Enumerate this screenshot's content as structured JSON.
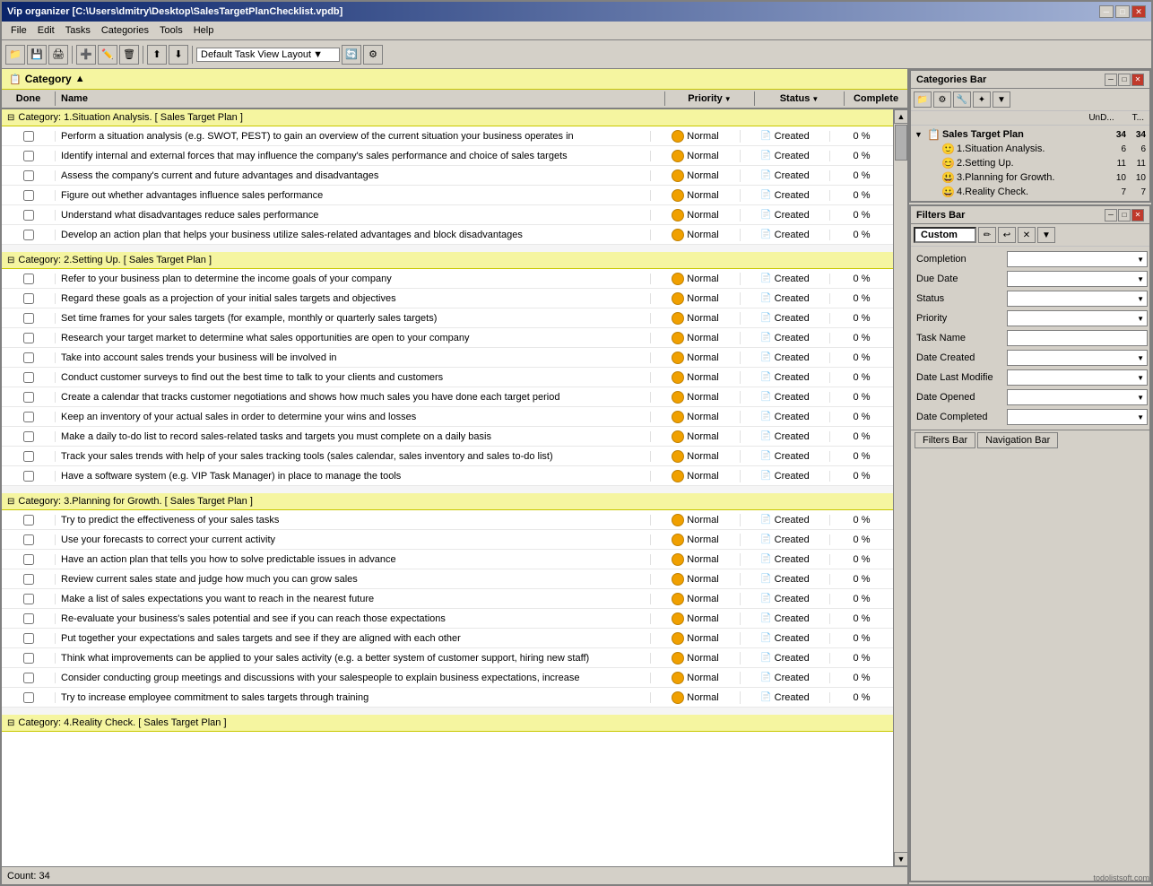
{
  "window": {
    "title": "Vip organizer [C:\\Users\\dmitry\\Desktop\\SalesTargetPlanChecklist.vpdb]",
    "minimize_label": "─",
    "maximize_label": "□",
    "close_label": "✕"
  },
  "menu": {
    "items": [
      "File",
      "Edit",
      "Tasks",
      "Categories",
      "Tools",
      "Help"
    ]
  },
  "toolbar": {
    "layout_label": "Default Task View Layout"
  },
  "task_pane": {
    "header": {
      "title": "Category",
      "sort_icon": "▲"
    },
    "columns": {
      "done": "Done",
      "name": "Name",
      "priority": "Priority",
      "status": "Status",
      "complete": "Complete"
    }
  },
  "categories": [
    {
      "id": "cat1",
      "label": "Category:  1.Situation Analysis.   [ Sales Target Plan ]",
      "tasks": [
        {
          "name": "Perform a situation analysis (e.g. SWOT, PEST) to gain an overview of the current situation your business operates in",
          "priority": "Normal",
          "status": "Created",
          "complete": "0 %"
        },
        {
          "name": "Identify internal and external forces that may influence the company's sales performance and choice of sales targets",
          "priority": "Normal",
          "status": "Created",
          "complete": "0 %"
        },
        {
          "name": "Assess the company's current and future advantages and disadvantages",
          "priority": "Normal",
          "status": "Created",
          "complete": "0 %"
        },
        {
          "name": "Figure out whether advantages influence sales performance",
          "priority": "Normal",
          "status": "Created",
          "complete": "0 %"
        },
        {
          "name": "Understand what disadvantages reduce sales performance",
          "priority": "Normal",
          "status": "Created",
          "complete": "0 %"
        },
        {
          "name": "Develop an action plan that helps your business utilize sales-related advantages and block disadvantages",
          "priority": "Normal",
          "status": "Created",
          "complete": "0 %"
        }
      ]
    },
    {
      "id": "cat2",
      "label": "Category:  2.Setting Up.   [ Sales Target Plan ]",
      "tasks": [
        {
          "name": "Refer to your business plan to determine the income goals of your company",
          "priority": "Normal",
          "status": "Created",
          "complete": "0 %"
        },
        {
          "name": "Regard these goals as a projection of your initial sales targets and objectives",
          "priority": "Normal",
          "status": "Created",
          "complete": "0 %"
        },
        {
          "name": "Set time frames for your sales targets (for example, monthly or quarterly sales targets)",
          "priority": "Normal",
          "status": "Created",
          "complete": "0 %"
        },
        {
          "name": "Research your target market to determine what sales opportunities are open to your company",
          "priority": "Normal",
          "status": "Created",
          "complete": "0 %"
        },
        {
          "name": "Take into account sales trends your business will be involved in",
          "priority": "Normal",
          "status": "Created",
          "complete": "0 %"
        },
        {
          "name": "Conduct customer surveys to find out the best time to talk to your clients and customers",
          "priority": "Normal",
          "status": "Created",
          "complete": "0 %"
        },
        {
          "name": "Create a calendar that tracks customer negotiations and shows how much sales you have done each target period",
          "priority": "Normal",
          "status": "Created",
          "complete": "0 %"
        },
        {
          "name": "Keep an inventory of your actual sales in order to determine your wins and losses",
          "priority": "Normal",
          "status": "Created",
          "complete": "0 %"
        },
        {
          "name": "Make a daily to-do list to record sales-related tasks and targets you must complete on a daily basis",
          "priority": "Normal",
          "status": "Created",
          "complete": "0 %"
        },
        {
          "name": "Track your sales trends with help of your sales tracking tools (sales calendar, sales inventory and sales to-do list)",
          "priority": "Normal",
          "status": "Created",
          "complete": "0 %"
        },
        {
          "name": "Have a software system (e.g. VIP Task Manager) in place to manage the tools",
          "priority": "Normal",
          "status": "Created",
          "complete": "0 %"
        }
      ]
    },
    {
      "id": "cat3",
      "label": "Category:  3.Planning for Growth.   [ Sales Target Plan ]",
      "tasks": [
        {
          "name": "Try to predict the effectiveness of your sales tasks",
          "priority": "Normal",
          "status": "Created",
          "complete": "0 %"
        },
        {
          "name": "Use your forecasts to correct your current activity",
          "priority": "Normal",
          "status": "Created",
          "complete": "0 %"
        },
        {
          "name": "Have an action plan that tells you how to solve predictable issues in advance",
          "priority": "Normal",
          "status": "Created",
          "complete": "0 %"
        },
        {
          "name": "Review current sales state and judge how much you can grow sales",
          "priority": "Normal",
          "status": "Created",
          "complete": "0 %"
        },
        {
          "name": "Make a list of sales expectations you want to reach in the nearest future",
          "priority": "Normal",
          "status": "Created",
          "complete": "0 %"
        },
        {
          "name": "Re-evaluate your business's sales potential and see if you can reach those expectations",
          "priority": "Normal",
          "status": "Created",
          "complete": "0 %"
        },
        {
          "name": "Put together your expectations and sales targets and see if they are aligned with each other",
          "priority": "Normal",
          "status": "Created",
          "complete": "0 %"
        },
        {
          "name": "Think what improvements can be applied to your sales activity (e.g. a better system of customer support, hiring new staff)",
          "priority": "Normal",
          "status": "Created",
          "complete": "0 %"
        },
        {
          "name": "Consider conducting group meetings and discussions with your salespeople to explain business expectations, increase",
          "priority": "Normal",
          "status": "Created",
          "complete": "0 %"
        },
        {
          "name": "Try to increase employee commitment to sales targets through training",
          "priority": "Normal",
          "status": "Created",
          "complete": "0 %"
        }
      ]
    },
    {
      "id": "cat4",
      "label": "Category:  4.Reality Check.   [ Sales Target Plan ]",
      "tasks": []
    }
  ],
  "status_bar": {
    "count_label": "Count:  34"
  },
  "categories_bar": {
    "title": "Categories Bar",
    "header_cols": [
      "UnD...",
      "T..."
    ],
    "tree": {
      "root": {
        "label": "Sales Target Plan",
        "und": "34",
        "t": "34",
        "children": [
          {
            "label": "1.Situation Analysis.",
            "icon": "🙂",
            "und": "6",
            "t": "6"
          },
          {
            "label": "2.Setting Up.",
            "icon": "😊",
            "und": "11",
            "t": "11"
          },
          {
            "label": "3.Planning for Growth.",
            "icon": "😃",
            "und": "10",
            "t": "10"
          },
          {
            "label": "4.Reality Check.",
            "icon": "😀",
            "und": "7",
            "t": "7"
          }
        ]
      }
    }
  },
  "filters_bar": {
    "title": "Filters Bar",
    "preset": "Custom",
    "filters": [
      {
        "label": "Completion",
        "has_dropdown": true
      },
      {
        "label": "Due Date",
        "has_dropdown": true
      },
      {
        "label": "Status",
        "has_dropdown": true
      },
      {
        "label": "Priority",
        "has_dropdown": true
      },
      {
        "label": "Task Name",
        "has_dropdown": false
      },
      {
        "label": "Date Created",
        "has_dropdown": true
      },
      {
        "label": "Date Last Modifie",
        "has_dropdown": true
      },
      {
        "label": "Date Opened",
        "has_dropdown": true
      },
      {
        "label": "Date Completed",
        "has_dropdown": true
      }
    ]
  },
  "bottom_tabs": [
    "Filters Bar",
    "Navigation Bar"
  ],
  "watermark": "todolistsoft.com"
}
